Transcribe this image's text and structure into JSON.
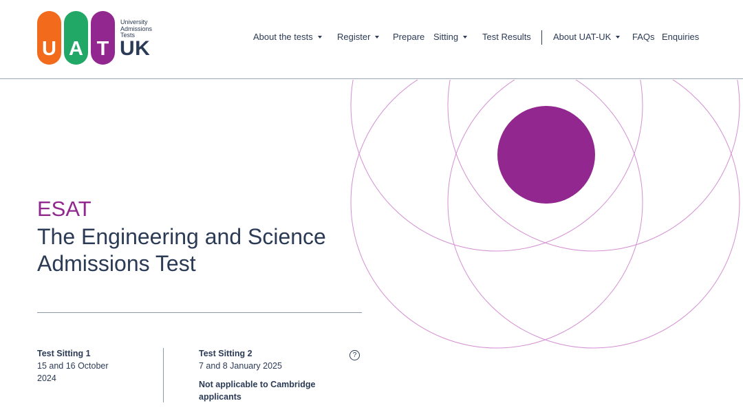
{
  "logo": {
    "letters": [
      "U",
      "A",
      "T"
    ],
    "small_lines": [
      "University",
      "Admissions",
      "Tests"
    ],
    "suffix": "UK",
    "colors": {
      "u": "#f26a1b",
      "a": "#22a866",
      "t": "#92278f"
    }
  },
  "nav": {
    "items": [
      {
        "label": "About the tests",
        "dropdown": true
      },
      {
        "label": "Register",
        "dropdown": true
      },
      {
        "label": "Prepare",
        "dropdown": false
      },
      {
        "label": "Sitting",
        "dropdown": true
      },
      {
        "label": "Test Results",
        "dropdown": false
      },
      {
        "label": "About UAT-UK",
        "dropdown": true
      },
      {
        "label": "FAQs",
        "dropdown": false
      },
      {
        "label": "Enquiries",
        "dropdown": false
      }
    ]
  },
  "hero": {
    "acronym": "ESAT",
    "title_line1": "The Engineering and Science",
    "title_line2": "Admissions Test",
    "accent_color": "#92278f"
  },
  "sittings": {
    "sitting1": {
      "heading": "Test Sitting 1",
      "date_line1": "15 and 16 October",
      "date_line2": "2024"
    },
    "sitting2": {
      "heading": "Test Sitting 2",
      "date": "7 and 8 January 2025",
      "note_line1": "Not applicable to Cambridge",
      "note_line2": "applicants"
    },
    "help_icon": "question-circle-icon",
    "help_glyph": "?"
  }
}
